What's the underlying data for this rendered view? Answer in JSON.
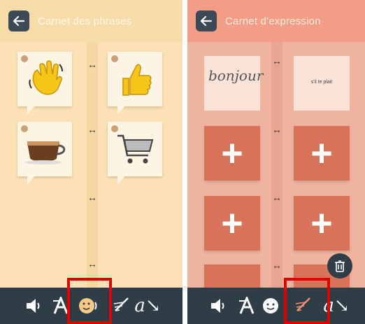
{
  "left_screen": {
    "title": "Carnet des phrases",
    "cards": [
      {
        "icon": "waving-hand-icon"
      },
      {
        "icon": "thumbs-up-icon"
      },
      {
        "icon": "coffee-cup-icon"
      },
      {
        "icon": "shopping-cart-icon"
      }
    ],
    "toolbar": [
      "speaker-icon",
      "font-style-icon",
      "emoji-speaking-icon",
      "pen-icon",
      "cursive-a-icon"
    ],
    "highlighted_tool": "emoji-speaking-icon"
  },
  "right_screen": {
    "title": "Carnet d'expression",
    "cards": [
      {
        "handwriting": "bonjour"
      },
      {
        "text": "s'il te plait"
      }
    ],
    "plus_label": "+",
    "toolbar": [
      "speaker-icon",
      "font-style-icon",
      "emoji-icon",
      "pen-icon",
      "cursive-a-icon"
    ],
    "highlighted_tool": "pen-icon"
  },
  "colors": {
    "highlight": "#e00000",
    "toolbar": "#2f3d46",
    "plus_tile": "#d9725a"
  }
}
